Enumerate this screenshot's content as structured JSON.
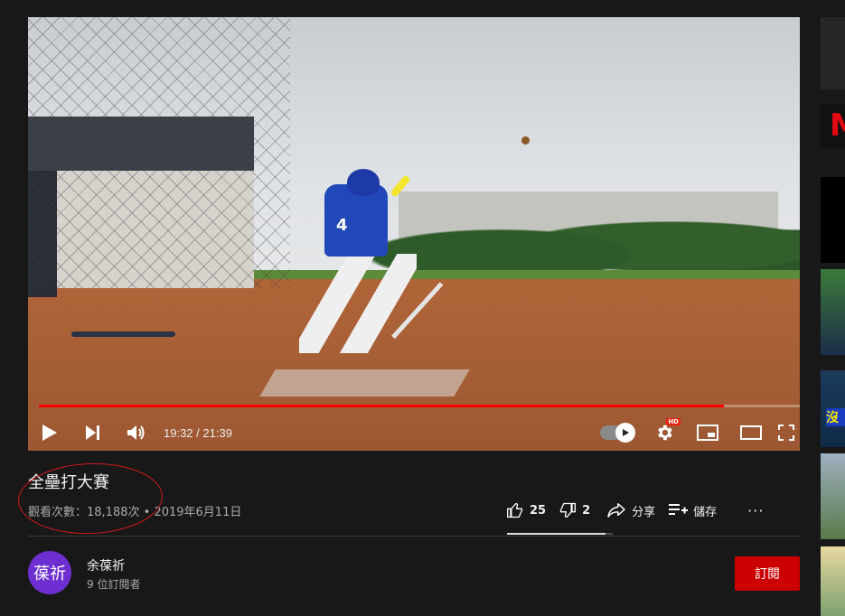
{
  "player": {
    "time_current": "19:32",
    "time_separator": " / ",
    "time_total": "21:39",
    "progress": 0.9,
    "jersey_number": "4",
    "hd_label": "HD"
  },
  "video": {
    "title": "全壘打大賽",
    "views": "觀看次數：18,188次",
    "dot": "•",
    "date": "2019年6月11日"
  },
  "actions": {
    "like_count": "25",
    "dislike_count": "2",
    "share_label": "分享",
    "save_label": "儲存",
    "more_label": "···",
    "like_ratio": 0.93
  },
  "channel": {
    "avatar_text": "葆祈",
    "name": "余葆祈",
    "subscribers": "9 位訂閱者",
    "subscribe_label": "訂閱"
  },
  "sidebar": {
    "thumb_label_1": "M",
    "thumb_label_2": "沒"
  },
  "colors": {
    "background": "#181818",
    "progress": "#ff0000",
    "subscribe": "#cc0000",
    "avatar": "#6d2fd1",
    "annotation": "#d31a1a"
  }
}
